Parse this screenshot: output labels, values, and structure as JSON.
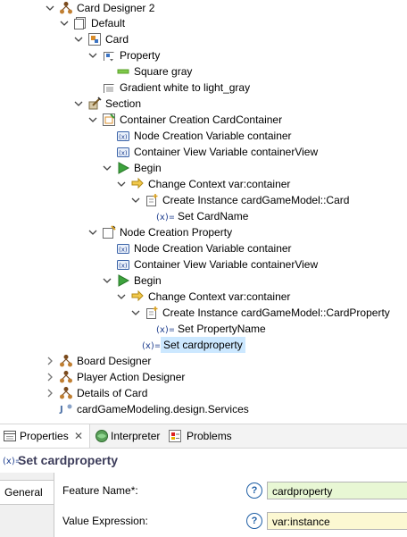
{
  "tree": {
    "items": [
      {
        "label": "Card Designer 2",
        "icon": "viewpoint-icon",
        "expanded": true
      },
      {
        "label": "Default",
        "icon": "layer-icon",
        "expanded": true
      },
      {
        "label": "Card",
        "icon": "node-mapping-icon",
        "expanded": true
      },
      {
        "label": "Property",
        "icon": "subnode-mapping-icon",
        "expanded": true
      },
      {
        "label": "Square gray",
        "icon": "square-style-icon"
      },
      {
        "label": "Gradient white to light_gray",
        "icon": "gradient-style-icon"
      },
      {
        "label": "Section",
        "icon": "tool-section-icon",
        "expanded": true
      },
      {
        "label": "Container Creation CardContainer",
        "icon": "container-creation-icon",
        "expanded": true
      },
      {
        "label": "Node Creation Variable container",
        "icon": "variable-icon"
      },
      {
        "label": "Container View Variable containerView",
        "icon": "variable-icon"
      },
      {
        "label": "Begin",
        "icon": "begin-icon",
        "expanded": true
      },
      {
        "label": "Change Context var:container",
        "icon": "change-context-icon",
        "expanded": true
      },
      {
        "label": "Create Instance cardGameModel::Card",
        "icon": "create-instance-icon",
        "expanded": true
      },
      {
        "label": "Set CardName",
        "icon": "set-value-icon"
      },
      {
        "label": "Node Creation Property",
        "icon": "node-creation-icon",
        "expanded": true
      },
      {
        "label": "Node Creation Variable container",
        "icon": "variable-icon"
      },
      {
        "label": "Container View Variable containerView",
        "icon": "variable-icon"
      },
      {
        "label": "Begin",
        "icon": "begin-icon",
        "expanded": true
      },
      {
        "label": "Change Context var:container",
        "icon": "change-context-icon",
        "expanded": true
      },
      {
        "label": "Create Instance cardGameModel::CardProperty",
        "icon": "create-instance-icon",
        "expanded": true
      },
      {
        "label": "Set PropertyName",
        "icon": "set-value-icon"
      },
      {
        "label": "Set cardproperty",
        "icon": "set-value-icon",
        "selected": true
      },
      {
        "label": "Board Designer",
        "icon": "viewpoint-icon",
        "expanded": false
      },
      {
        "label": "Player Action Designer",
        "icon": "viewpoint-icon",
        "expanded": false
      },
      {
        "label": "Details of Card",
        "icon": "viewpoint-icon",
        "expanded": false
      },
      {
        "label": "cardGameModeling.design.Services",
        "icon": "java-extension-icon"
      }
    ]
  },
  "views": {
    "tabs": [
      {
        "label": "Properties",
        "icon": "properties-icon",
        "active": true,
        "close": "✕"
      },
      {
        "label": "Interpreter",
        "icon": "interpreter-icon"
      },
      {
        "label": "Problems",
        "icon": "problems-icon"
      }
    ],
    "title": "Set cardproperty",
    "title_icon": "set-value-icon",
    "sidebar_tab": "General",
    "fields": [
      {
        "label": "Feature Name*:",
        "value": "cardproperty",
        "help": "?",
        "bg": "#e8f7d4"
      },
      {
        "label": "Value Expression:",
        "value": "var:instance",
        "help": "?",
        "bg": "#fcf8d2"
      }
    ]
  },
  "colors": {
    "selection": "#cce8ff",
    "accent_blue": "#1f5fa5",
    "feature_field_bg": "#e8f7d4",
    "expression_field_bg": "#fcf8d2"
  }
}
